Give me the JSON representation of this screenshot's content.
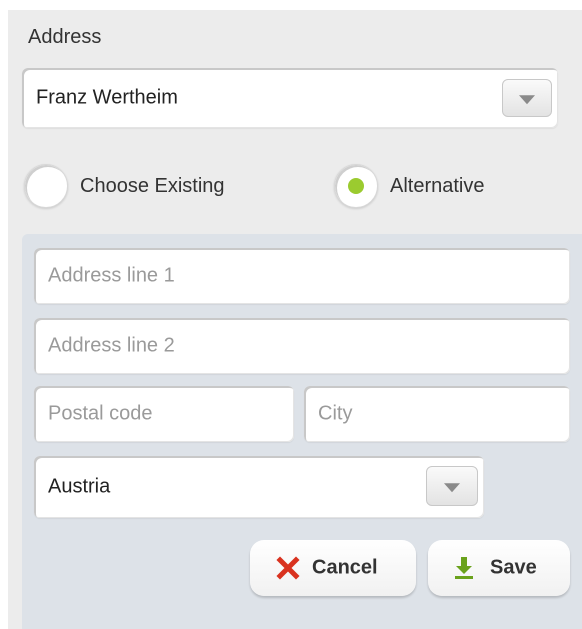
{
  "address": {
    "label": "Address",
    "selected_value": "Franz Wertheim"
  },
  "mode": {
    "options": [
      {
        "label": "Choose Existing",
        "selected": false
      },
      {
        "label": "Alternative",
        "selected": true
      }
    ]
  },
  "form": {
    "address_line_1_placeholder": "Address line 1",
    "address_line_2_placeholder": "Address line 2",
    "postal_code_placeholder": "Postal code",
    "city_placeholder": "City",
    "country_value": "Austria"
  },
  "actions": {
    "cancel_label": "Cancel",
    "save_label": "Save"
  },
  "colors": {
    "accent_green": "#9bcb2f",
    "cancel_red": "#d9321f",
    "save_green": "#6aa21c"
  },
  "icons": {
    "cancel": "close-icon",
    "save": "download-icon",
    "dropdown": "chevron-down-icon"
  }
}
